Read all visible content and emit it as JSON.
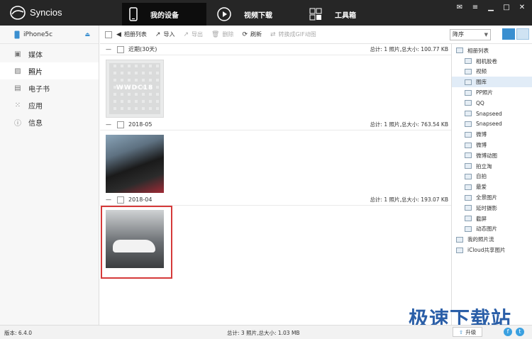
{
  "app": {
    "name": "Syncios"
  },
  "nav_tabs": [
    {
      "label": "我的设备",
      "icon": "phone-icon",
      "active": true
    },
    {
      "label": "视频下载",
      "icon": "play-icon",
      "active": false
    },
    {
      "label": "工具箱",
      "icon": "toolbox-icon",
      "active": false
    }
  ],
  "window_buttons": [
    "message-icon",
    "menu-icon",
    "minimize-icon",
    "maximize-icon",
    "close-icon"
  ],
  "device": {
    "name": "iPhone5c"
  },
  "sidebar": {
    "items": [
      {
        "label": "媒体",
        "icon": "media-icon",
        "active": false
      },
      {
        "label": "照片",
        "icon": "photo-icon",
        "active": true
      },
      {
        "label": "电子书",
        "icon": "ebook-icon",
        "active": false
      },
      {
        "label": "应用",
        "icon": "apps-icon",
        "active": false
      },
      {
        "label": "信息",
        "icon": "info-icon",
        "active": false
      }
    ]
  },
  "toolbar": {
    "album_list": "相册列表",
    "import": "导入",
    "export": "导出",
    "delete": "删除",
    "refresh": "刷新",
    "to_gif": "转换成GIF动图",
    "sort": "降序"
  },
  "groups": [
    {
      "title": "近期(30天)",
      "stats": "总计: 1 照片,总大小: 100.77 KB",
      "thumb_text": "WWDC18"
    },
    {
      "title": "2018-05",
      "stats": "总计: 1 照片,总大小: 763.54 KB"
    },
    {
      "title": "2018-04",
      "stats": "总计: 1 照片,总大小: 193.07 KB"
    }
  ],
  "albums": {
    "items": [
      {
        "label": "相册列表",
        "level": 1,
        "selected": false
      },
      {
        "label": "相机胶卷",
        "level": 2,
        "selected": false
      },
      {
        "label": "视频",
        "level": 2,
        "selected": false
      },
      {
        "label": "图库",
        "level": 2,
        "selected": true
      },
      {
        "label": "PP照片",
        "level": 2,
        "selected": false
      },
      {
        "label": "QQ",
        "level": 2,
        "selected": false
      },
      {
        "label": "Snapseed",
        "level": 2,
        "selected": false
      },
      {
        "label": "Snapseed",
        "level": 2,
        "selected": false
      },
      {
        "label": "微博",
        "level": 2,
        "selected": false
      },
      {
        "label": "微博",
        "level": 2,
        "selected": false
      },
      {
        "label": "微博动图",
        "level": 2,
        "selected": false
      },
      {
        "label": "拍立淘",
        "level": 2,
        "selected": false
      },
      {
        "label": "自拍",
        "level": 2,
        "selected": false
      },
      {
        "label": "最爱",
        "level": 2,
        "selected": false
      },
      {
        "label": "全景图片",
        "level": 2,
        "selected": false
      },
      {
        "label": "延时摄影",
        "level": 2,
        "selected": false
      },
      {
        "label": "截屏",
        "level": 2,
        "selected": false
      },
      {
        "label": "动态图片",
        "level": 2,
        "selected": false
      },
      {
        "label": "我的照片流",
        "level": 1,
        "selected": false
      },
      {
        "label": "iCloud共享图片",
        "level": 1,
        "selected": false
      }
    ]
  },
  "status": {
    "version": "版本: 6.4.0",
    "total": "总计: 3 照片,总大小: 1.03 MB",
    "upgrade": "升级"
  },
  "watermark": "极速下载站",
  "colors": {
    "titlebar": "#262626",
    "accent": "#3a8fd0",
    "selection_border": "#d53a3a"
  }
}
